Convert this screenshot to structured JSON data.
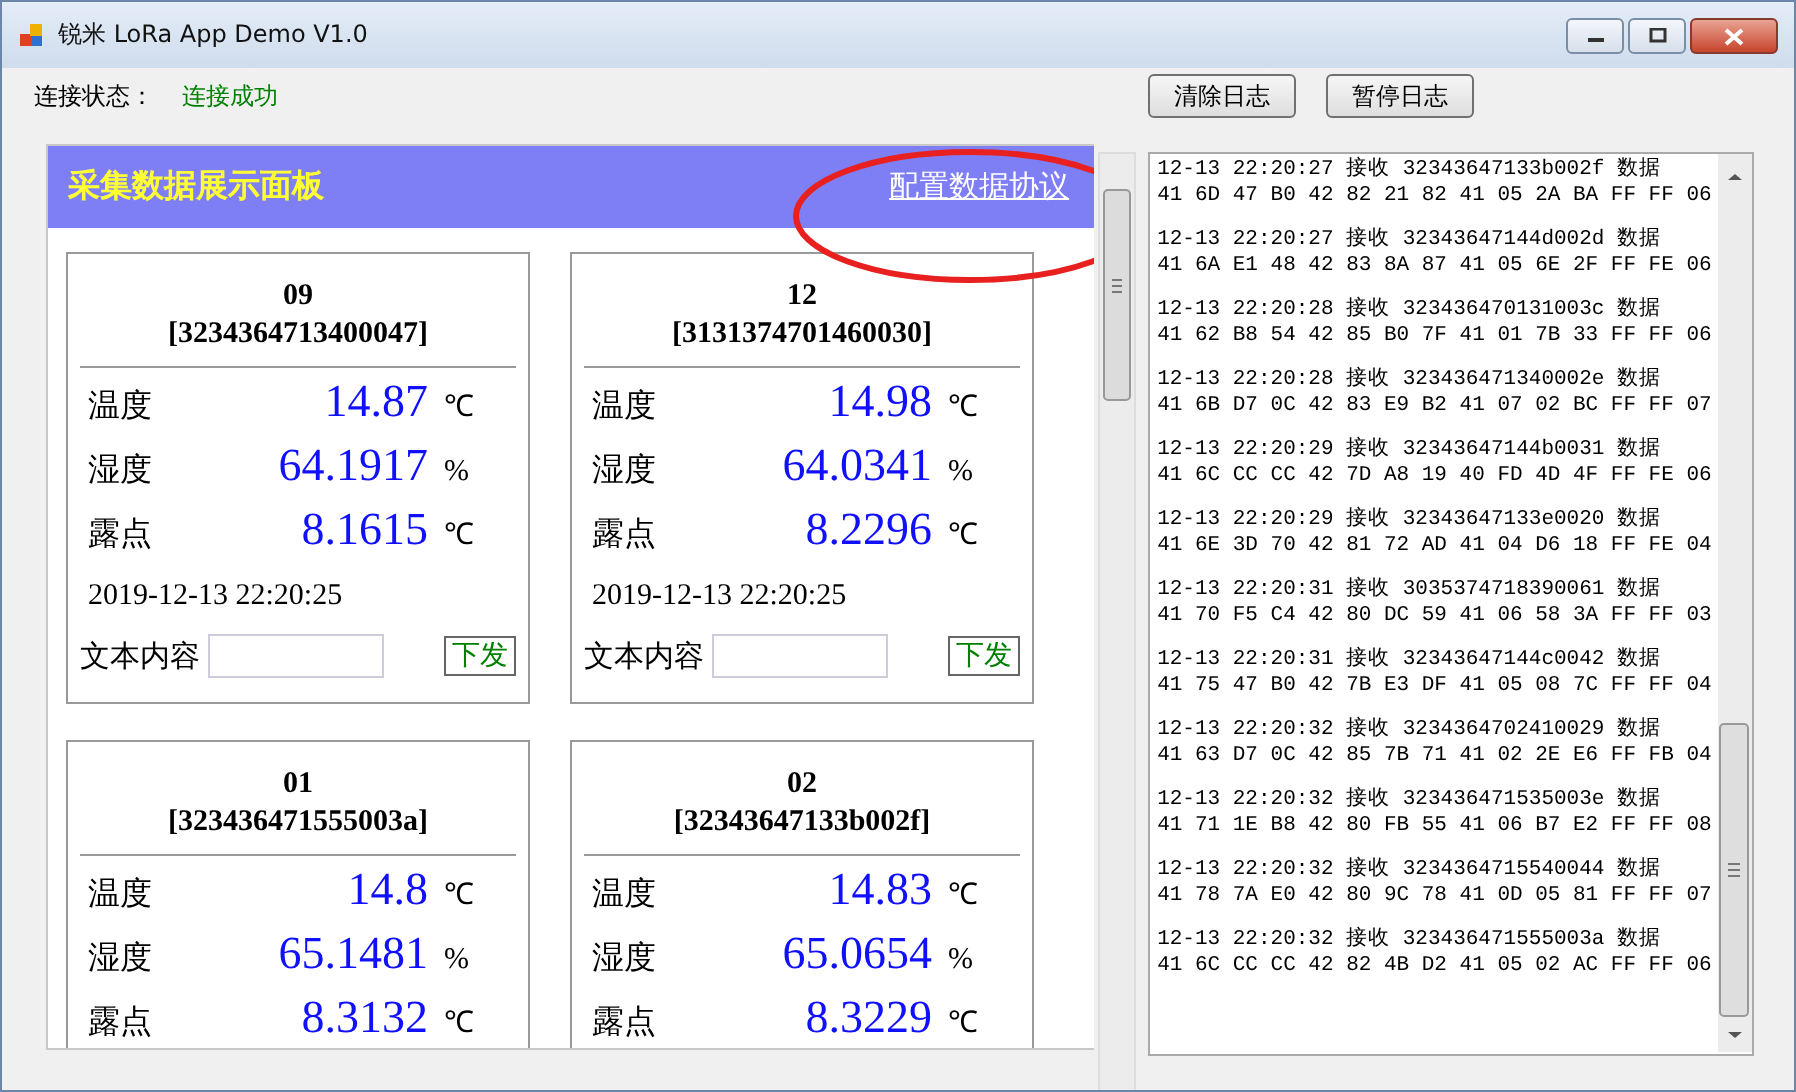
{
  "window": {
    "title": "锐米 LoRa App Demo V1.0"
  },
  "status": {
    "label": "连接状态：",
    "value": "连接成功"
  },
  "buttons": [
    "清除日志",
    "暂停日志"
  ],
  "panel": {
    "title": "采集数据展示面板",
    "link": "配置数据协议",
    "cards": [
      {
        "name": "09",
        "id": "[3234364713400047]",
        "rows": [
          {
            "label": "温度",
            "value": "14.87",
            "unit": "℃"
          },
          {
            "label": "湿度",
            "value": "64.1917",
            "unit": "%"
          },
          {
            "label": "露点",
            "value": "8.1615",
            "unit": "℃"
          }
        ],
        "timestamp": "2019-12-13 22:20:25",
        "text_label": "文本内容",
        "send": "下发"
      },
      {
        "name": "12",
        "id": "[3131374701460030]",
        "rows": [
          {
            "label": "温度",
            "value": "14.98",
            "unit": "℃"
          },
          {
            "label": "湿度",
            "value": "64.0341",
            "unit": "%"
          },
          {
            "label": "露点",
            "value": "8.2296",
            "unit": "℃"
          }
        ],
        "timestamp": "2019-12-13 22:20:25",
        "text_label": "文本内容",
        "send": "下发"
      },
      {
        "name": "01",
        "id": "[323436471555003a]",
        "rows": [
          {
            "label": "温度",
            "value": "14.8",
            "unit": "℃"
          },
          {
            "label": "湿度",
            "value": "65.1481",
            "unit": "%"
          },
          {
            "label": "露点",
            "value": "8.3132",
            "unit": "℃"
          }
        ]
      },
      {
        "name": "02",
        "id": "[32343647133b002f]",
        "rows": [
          {
            "label": "温度",
            "value": "14.83",
            "unit": "℃"
          },
          {
            "label": "湿度",
            "value": "65.0654",
            "unit": "%"
          },
          {
            "label": "露点",
            "value": "8.3229",
            "unit": "℃"
          }
        ]
      }
    ]
  },
  "log": [
    {
      "head": "12-13 22:20:27 接收 32343647133b002f 数据",
      "data": "41 6D 47 B0 42 82 21 82 41 05 2A BA FF FF 06"
    },
    {
      "head": "12-13 22:20:27 接收 32343647144d002d 数据",
      "data": "41 6A E1 48 42 83 8A 87 41 05 6E 2F FF FE 06"
    },
    {
      "head": "12-13 22:20:28 接收 323436470131003c 数据",
      "data": "41 62 B8 54 42 85 B0 7F 41 01 7B 33 FF FF 06"
    },
    {
      "head": "12-13 22:20:28 接收 323436471340002e 数据",
      "data": "41 6B D7 0C 42 83 E9 B2 41 07 02 BC FF FF 07"
    },
    {
      "head": "12-13 22:20:29 接收 32343647144b0031 数据",
      "data": "41 6C CC CC 42 7D A8 19 40 FD 4D 4F FF FE 06"
    },
    {
      "head": "12-13 22:20:29 接收 32343647133e0020 数据",
      "data": "41 6E 3D 70 42 81 72 AD 41 04 D6 18 FF FE 04"
    },
    {
      "head": "12-13 22:20:31 接收 3035374718390061 数据",
      "data": "41 70 F5 C4 42 80 DC 59 41 06 58 3A FF FF 03"
    },
    {
      "head": "12-13 22:20:31 接收 32343647144c0042 数据",
      "data": "41 75 47 B0 42 7B E3 DF 41 05 08 7C FF FF 04"
    },
    {
      "head": "12-13 22:20:32 接收 3234364702410029 数据",
      "data": "41 63 D7 0C 42 85 7B 71 41 02 2E E6 FF FB 04"
    },
    {
      "head": "12-13 22:20:32 接收 323436471535003e 数据",
      "data": "41 71 1E B8 42 80 FB 55 41 06 B7 E2 FF FF 08"
    },
    {
      "head": "12-13 22:20:32 接收 3234364715540044 数据",
      "data": "41 78 7A E0 42 80 9C 78 41 0D 05 81 FF FF 07"
    },
    {
      "head": "12-13 22:20:32 接收 323436471555003a 数据",
      "data": "41 6C CC CC 42 82 4B D2 41 05 02 AC FF FF 06"
    }
  ]
}
